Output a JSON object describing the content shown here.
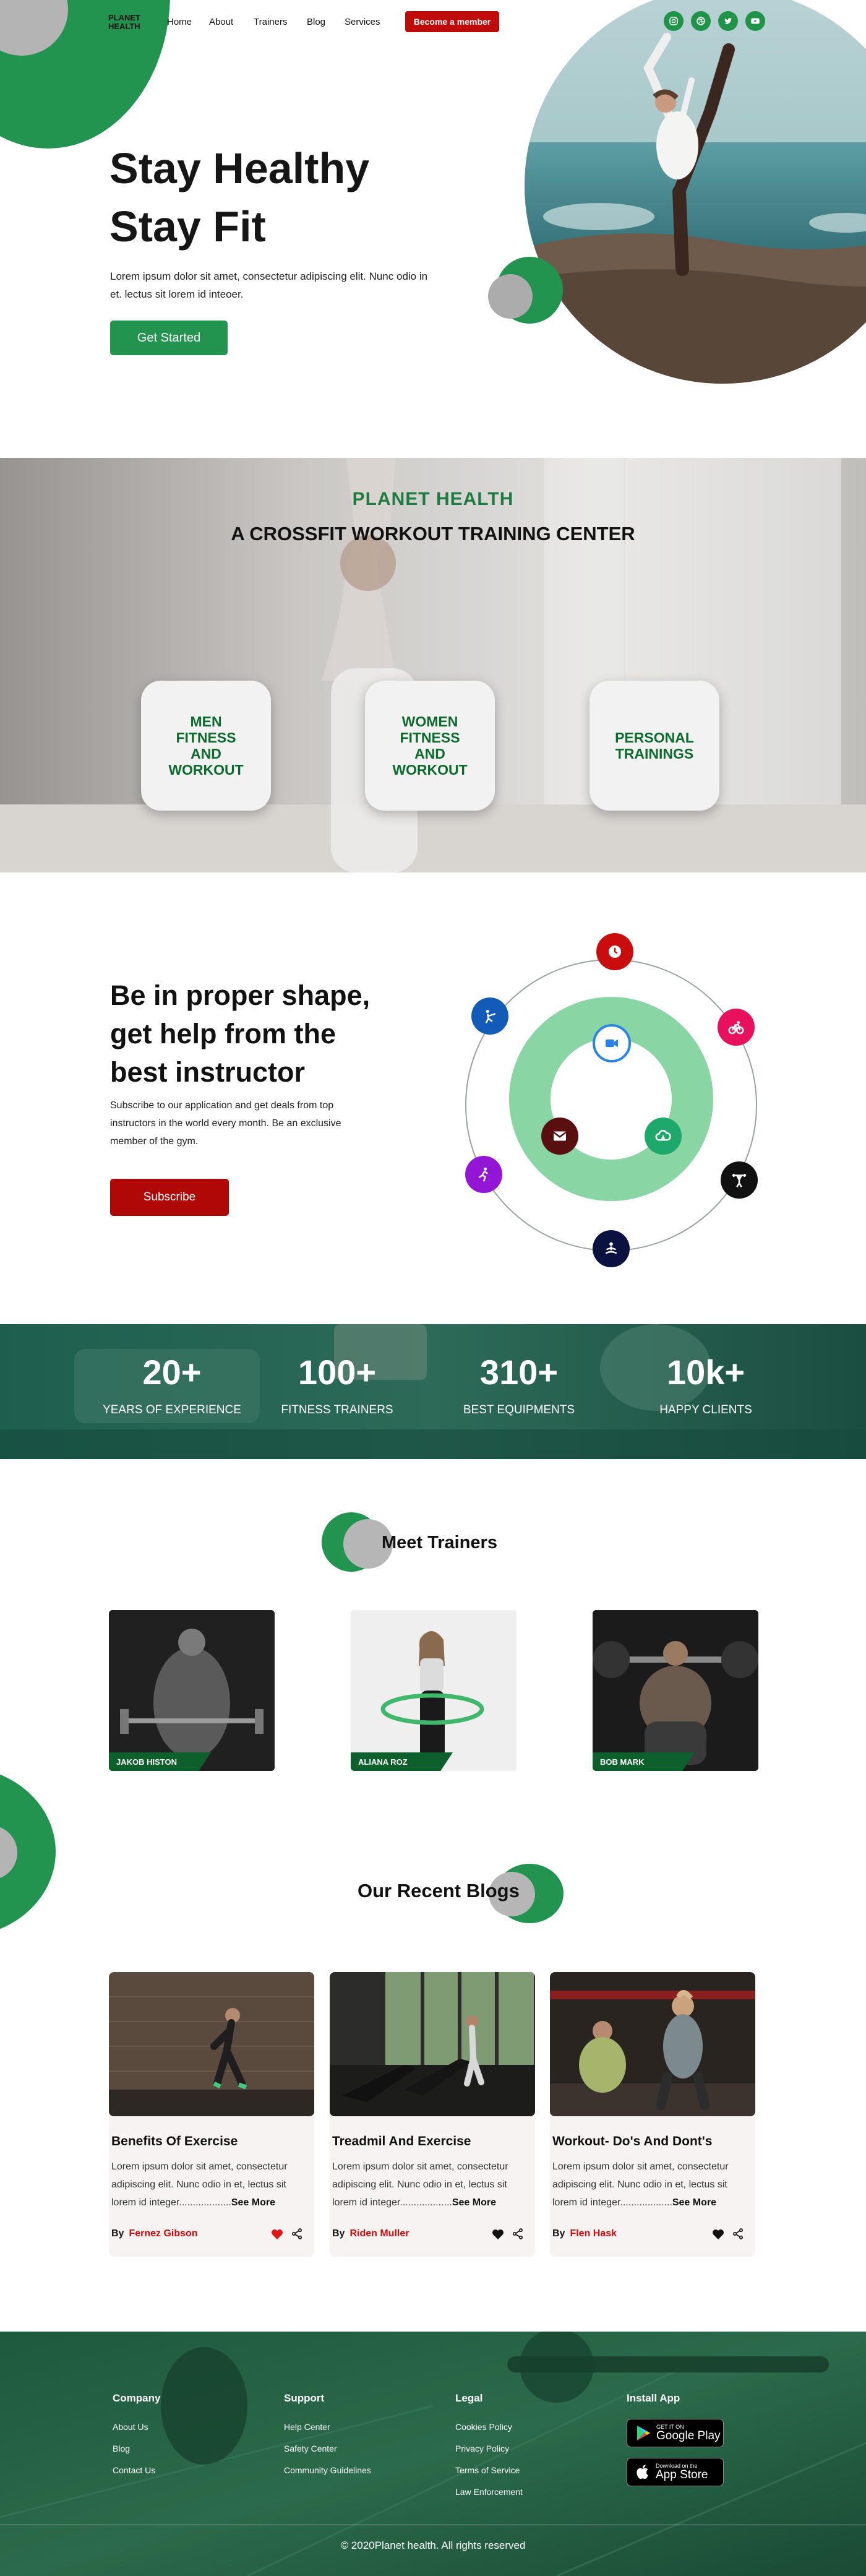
{
  "header": {
    "logo": "PLANET HEALTH",
    "nav": [
      "Home",
      "About",
      "Trainers",
      "Blog",
      "Services"
    ],
    "cta": "Become a member",
    "social_icons": [
      "instagram-icon",
      "dribbble-icon",
      "twitter-icon",
      "youtube-icon"
    ]
  },
  "hero": {
    "title_line1": "Stay Healthy",
    "title_line2": "Stay Fit",
    "text": "Lorem ipsum dolor sit amet, consectetur adipiscing elit. Nunc odio in et. lectus sit lorem id inteoer.",
    "button": "Get Started"
  },
  "training_center": {
    "label": "PLANET HEALTH",
    "heading": "A CROSSFIT WORKOUT TRAINING CENTER",
    "cards": [
      "MEN FITNESS AND WORKOUT",
      "WOMEN FITNESS AND WORKOUT",
      "PERSONAL TRAININGS"
    ]
  },
  "proper_shape": {
    "title": "Be in proper shape, get help from the best instructor",
    "text": "Subscribe to our application and get deals from top instructors in the world every month. Be an exclusive member of the gym.",
    "button": "Subscribe",
    "orbit_icons": [
      "clock-icon",
      "bike-icon",
      "weightlifter-icon",
      "meditation-icon",
      "runner-icon",
      "karate-icon",
      "video-icon",
      "mail-icon",
      "cloud-icon"
    ]
  },
  "stats": [
    {
      "number": "20+",
      "label": "YEARS OF EXPERIENCE"
    },
    {
      "number": "100+",
      "label": "FITNESS TRAINERS"
    },
    {
      "number": "310+",
      "label": "BEST EQUIPMENTS"
    },
    {
      "number": "10k+",
      "label": "HAPPY CLIENTS"
    }
  ],
  "trainers": {
    "title": "Meet Trainers",
    "items": [
      {
        "name": "JAKOB HISTON"
      },
      {
        "name": "ALIANA ROZ"
      },
      {
        "name": "BOB MARK"
      }
    ]
  },
  "blogs": {
    "title": "Our Recent Blogs",
    "by": "By",
    "more": "See More",
    "items": [
      {
        "title": "Benefits Of Exercise",
        "text": "Lorem ipsum dolor sit amet, consectetur adipiscing elit. Nunc odio in et, lectus sit lorem id integer...................",
        "author": "Fernez Gibson",
        "liked": true
      },
      {
        "title": "Treadmil And Exercise",
        "text": "Lorem ipsum dolor sit amet, consectetur adipiscing elit. Nunc odio in et, lectus sit lorem id integer...................",
        "author": "Riden Muller",
        "liked": false
      },
      {
        "title": "Workout- Do's And Dont's",
        "text": "Lorem ipsum dolor sit amet, consectetur adipiscing elit. Nunc odio in et, lectus sit lorem id integer...................",
        "author": "Flen Hask",
        "liked": false
      }
    ]
  },
  "footer": {
    "columns": [
      {
        "title": "Company",
        "links": [
          "About Us",
          "Blog",
          "Contact Us"
        ]
      },
      {
        "title": "Support",
        "links": [
          "Help Center",
          "Safety Center",
          "Community Guidelines"
        ]
      },
      {
        "title": "Legal",
        "links": [
          "Cookies Policy",
          "Privacy Policy",
          "Terms of Service",
          "Law Enforcement"
        ]
      }
    ],
    "install_title": "Install App",
    "google_play": {
      "small": "GET IT ON",
      "big": "Google Play"
    },
    "app_store": {
      "small": "Download on the",
      "big": "App Store"
    },
    "copyright": "© 2020Planet health. All rights reserved"
  },
  "colors": {
    "brand_green": "#239450",
    "brand_red": "#c00b0b",
    "dark_green": "#0d5f2c"
  }
}
